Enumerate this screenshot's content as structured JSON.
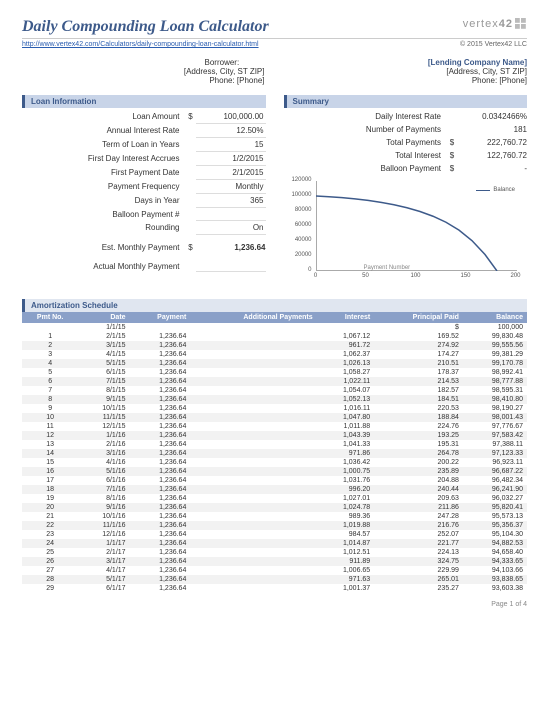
{
  "header": {
    "title": "Daily Compounding Loan Calculator",
    "logo_text": "vertex",
    "logo_suffix": "42",
    "url": "http://www.vertex42.com/Calculators/daily-compounding-loan-calculator.html",
    "copyright": "© 2015 Vertex42 LLC"
  },
  "parties": {
    "borrower_label": "Borrower:",
    "borrower_address": "[Address, City, ST  ZIP]",
    "borrower_phone": "Phone: [Phone]",
    "lender_name": "[Lending Company Name]",
    "lender_address": "[Address, City, ST  ZIP]",
    "lender_phone": "Phone: [Phone]"
  },
  "loan_info": {
    "header": "Loan Information",
    "rows": [
      {
        "label": "Loan Amount",
        "cur": "$",
        "val": "100,000.00"
      },
      {
        "label": "Annual Interest Rate",
        "cur": "",
        "val": "12.50%"
      },
      {
        "label": "Term of Loan in Years",
        "cur": "",
        "val": "15"
      },
      {
        "label": "First Day Interest Accrues",
        "cur": "",
        "val": "1/2/2015"
      },
      {
        "label": "First Payment Date",
        "cur": "",
        "val": "2/1/2015"
      },
      {
        "label": "Payment Frequency",
        "cur": "",
        "val": "Monthly"
      },
      {
        "label": "Days in Year",
        "cur": "",
        "val": "365"
      },
      {
        "label": "Balloon Payment #",
        "cur": "",
        "val": ""
      },
      {
        "label": "Rounding",
        "cur": "",
        "val": "On"
      }
    ],
    "est_label": "Est. Monthly Payment",
    "est_cur": "$",
    "est_val": "1,236.64",
    "actual_label": "Actual Monthly Payment"
  },
  "summary": {
    "header": "Summary",
    "rows": [
      {
        "label": "Daily Interest Rate",
        "cur": "",
        "val": "0.0342466%"
      },
      {
        "label": "Number of Payments",
        "cur": "",
        "val": "181"
      },
      {
        "label": "Total Payments",
        "cur": "$",
        "val": "222,760.72"
      },
      {
        "label": "Total Interest",
        "cur": "$",
        "val": "122,760.72"
      },
      {
        "label": "Balloon Payment",
        "cur": "$",
        "val": "-"
      }
    ]
  },
  "chart_data": {
    "type": "line",
    "series": [
      {
        "name": "Balance",
        "values": [
          100000,
          99000,
          97800,
          96200,
          94100,
          91500,
          88300,
          84300,
          79300,
          73000,
          65000,
          54500,
          40500,
          22000,
          0
        ]
      }
    ],
    "x": [
      0,
      13,
      26,
      39,
      52,
      65,
      78,
      91,
      104,
      117,
      130,
      143,
      156,
      169,
      181
    ],
    "xlabel": "Payment Number",
    "ylabel": "",
    "ylim": [
      0,
      120000
    ],
    "xlim": [
      0,
      200
    ],
    "yticks": [
      "0",
      "20000",
      "40000",
      "60000",
      "80000",
      "100000",
      "120000"
    ],
    "xticks": [
      "0",
      "50",
      "100",
      "150",
      "200"
    ],
    "legend": "Balance"
  },
  "amort": {
    "header": "Amortization Schedule",
    "cols": [
      "Pmt No.",
      "Date",
      "Payment",
      "Additional Payments",
      "Interest",
      "Principal Paid",
      "Balance"
    ],
    "init_row": {
      "date": "1/1/15",
      "cur": "$",
      "balance": "100,000"
    },
    "rows": [
      {
        "n": "1",
        "date": "2/1/15",
        "pmt": "1,236.64",
        "add": "",
        "int": "1,067.12",
        "prin": "169.52",
        "bal": "99,830.48"
      },
      {
        "n": "2",
        "date": "3/1/15",
        "pmt": "1,236.64",
        "add": "",
        "int": "961.72",
        "prin": "274.92",
        "bal": "99,555.56"
      },
      {
        "n": "3",
        "date": "4/1/15",
        "pmt": "1,236.64",
        "add": "",
        "int": "1,062.37",
        "prin": "174.27",
        "bal": "99,381.29"
      },
      {
        "n": "4",
        "date": "5/1/15",
        "pmt": "1,236.64",
        "add": "",
        "int": "1,026.13",
        "prin": "210.51",
        "bal": "99,170.78"
      },
      {
        "n": "5",
        "date": "6/1/15",
        "pmt": "1,236.64",
        "add": "",
        "int": "1,058.27",
        "prin": "178.37",
        "bal": "98,992.41"
      },
      {
        "n": "6",
        "date": "7/1/15",
        "pmt": "1,236.64",
        "add": "",
        "int": "1,022.11",
        "prin": "214.53",
        "bal": "98,777.88"
      },
      {
        "n": "7",
        "date": "8/1/15",
        "pmt": "1,236.64",
        "add": "",
        "int": "1,054.07",
        "prin": "182.57",
        "bal": "98,595.31"
      },
      {
        "n": "8",
        "date": "9/1/15",
        "pmt": "1,236.64",
        "add": "",
        "int": "1,052.13",
        "prin": "184.51",
        "bal": "98,410.80"
      },
      {
        "n": "9",
        "date": "10/1/15",
        "pmt": "1,236.64",
        "add": "",
        "int": "1,016.11",
        "prin": "220.53",
        "bal": "98,190.27"
      },
      {
        "n": "10",
        "date": "11/1/15",
        "pmt": "1,236.64",
        "add": "",
        "int": "1,047.80",
        "prin": "188.84",
        "bal": "98,001.43"
      },
      {
        "n": "11",
        "date": "12/1/15",
        "pmt": "1,236.64",
        "add": "",
        "int": "1,011.88",
        "prin": "224.76",
        "bal": "97,776.67"
      },
      {
        "n": "12",
        "date": "1/1/16",
        "pmt": "1,236.64",
        "add": "",
        "int": "1,043.39",
        "prin": "193.25",
        "bal": "97,583.42"
      },
      {
        "n": "13",
        "date": "2/1/16",
        "pmt": "1,236.64",
        "add": "",
        "int": "1,041.33",
        "prin": "195.31",
        "bal": "97,388.11"
      },
      {
        "n": "14",
        "date": "3/1/16",
        "pmt": "1,236.64",
        "add": "",
        "int": "971.86",
        "prin": "264.78",
        "bal": "97,123.33"
      },
      {
        "n": "15",
        "date": "4/1/16",
        "pmt": "1,236.64",
        "add": "",
        "int": "1,036.42",
        "prin": "200.22",
        "bal": "96,923.11"
      },
      {
        "n": "16",
        "date": "5/1/16",
        "pmt": "1,236.64",
        "add": "",
        "int": "1,000.75",
        "prin": "235.89",
        "bal": "96,687.22"
      },
      {
        "n": "17",
        "date": "6/1/16",
        "pmt": "1,236.64",
        "add": "",
        "int": "1,031.76",
        "prin": "204.88",
        "bal": "96,482.34"
      },
      {
        "n": "18",
        "date": "7/1/16",
        "pmt": "1,236.64",
        "add": "",
        "int": "996.20",
        "prin": "240.44",
        "bal": "96,241.90"
      },
      {
        "n": "19",
        "date": "8/1/16",
        "pmt": "1,236.64",
        "add": "",
        "int": "1,027.01",
        "prin": "209.63",
        "bal": "96,032.27"
      },
      {
        "n": "20",
        "date": "9/1/16",
        "pmt": "1,236.64",
        "add": "",
        "int": "1,024.78",
        "prin": "211.86",
        "bal": "95,820.41"
      },
      {
        "n": "21",
        "date": "10/1/16",
        "pmt": "1,236.64",
        "add": "",
        "int": "989.36",
        "prin": "247.28",
        "bal": "95,573.13"
      },
      {
        "n": "22",
        "date": "11/1/16",
        "pmt": "1,236.64",
        "add": "",
        "int": "1,019.88",
        "prin": "216.76",
        "bal": "95,356.37"
      },
      {
        "n": "23",
        "date": "12/1/16",
        "pmt": "1,236.64",
        "add": "",
        "int": "984.57",
        "prin": "252.07",
        "bal": "95,104.30"
      },
      {
        "n": "24",
        "date": "1/1/17",
        "pmt": "1,236.64",
        "add": "",
        "int": "1,014.87",
        "prin": "221.77",
        "bal": "94,882.53"
      },
      {
        "n": "25",
        "date": "2/1/17",
        "pmt": "1,236.64",
        "add": "",
        "int": "1,012.51",
        "prin": "224.13",
        "bal": "94,658.40"
      },
      {
        "n": "26",
        "date": "3/1/17",
        "pmt": "1,236.64",
        "add": "",
        "int": "911.89",
        "prin": "324.75",
        "bal": "94,333.65"
      },
      {
        "n": "27",
        "date": "4/1/17",
        "pmt": "1,236.64",
        "add": "",
        "int": "1,006.65",
        "prin": "229.99",
        "bal": "94,103.66"
      },
      {
        "n": "28",
        "date": "5/1/17",
        "pmt": "1,236.64",
        "add": "",
        "int": "971.63",
        "prin": "265.01",
        "bal": "93,838.65"
      },
      {
        "n": "29",
        "date": "6/1/17",
        "pmt": "1,236.64",
        "add": "",
        "int": "1,001.37",
        "prin": "235.27",
        "bal": "93,603.38"
      }
    ]
  },
  "footer": "Page 1 of 4"
}
